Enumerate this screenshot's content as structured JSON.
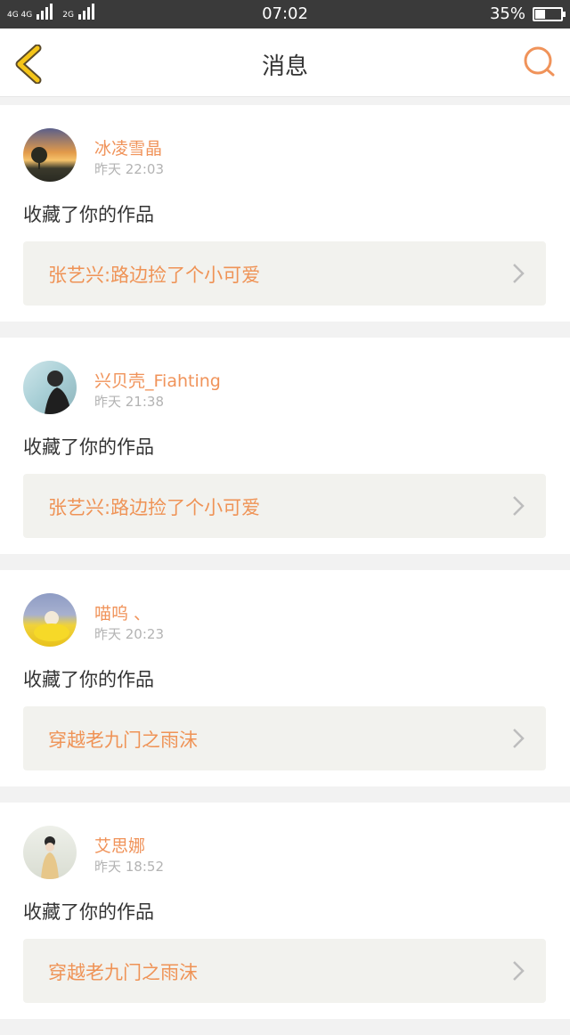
{
  "status_bar": {
    "network": "4G 4G",
    "network2": "2G",
    "time": "07:02",
    "battery": "35%",
    "battery_level": 0.35
  },
  "header": {
    "title": "消息",
    "back_icon": "chevron-left-icon",
    "search_icon": "search-icon"
  },
  "notifications": [
    {
      "user": "冰凌雪晶",
      "time": "昨天 22:03",
      "action": "收藏了你的作品",
      "work": "张艺兴:路边捡了个小可爱"
    },
    {
      "user": "兴贝壳_Fiahting",
      "time": "昨天 21:38",
      "action": "收藏了你的作品",
      "work": "张艺兴:路边捡了个小可爱"
    },
    {
      "user": "喵呜 、",
      "time": "昨天 20:23",
      "action": "收藏了你的作品",
      "work": "穿越老九门之雨沫"
    },
    {
      "user": "艾思娜",
      "time": "昨天 18:52",
      "action": "收藏了你的作品",
      "work": "穿越老九门之雨沫"
    }
  ],
  "colors": {
    "accent": "#f0935a",
    "back_icon": "#f5c518",
    "status_bar": "#3a3a3a"
  }
}
